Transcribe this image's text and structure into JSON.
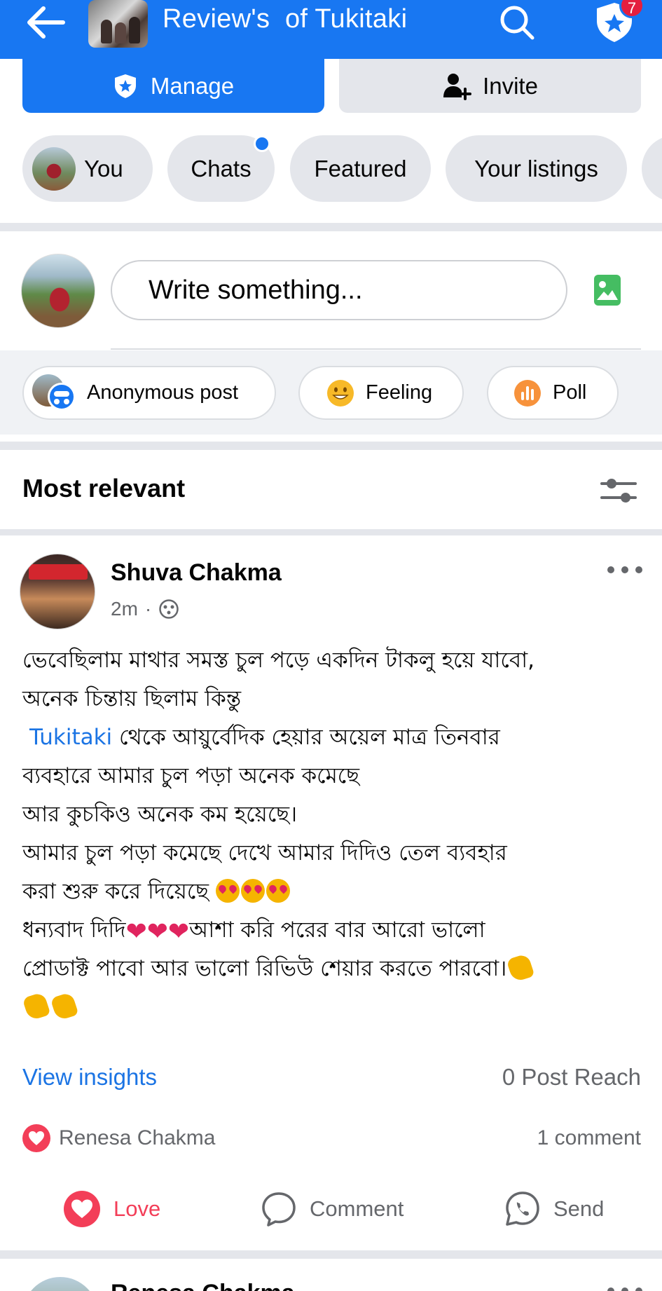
{
  "header": {
    "title": "Review's  of Tukitaki",
    "notification_count": "7"
  },
  "actions": {
    "manage_label": "Manage",
    "invite_label": "Invite"
  },
  "chips": {
    "you": "You",
    "chats": "Chats",
    "featured": "Featured",
    "listings": "Your listings"
  },
  "composer": {
    "placeholder": "Write something...",
    "anonymous_label": "Anonymous post",
    "feeling_label": "Feeling",
    "poll_label": "Poll"
  },
  "sort": {
    "label": "Most relevant"
  },
  "post": {
    "author": "Shuva Chakma",
    "time": "2m",
    "separator": "·",
    "lines": {
      "l1": "ভেবেছিলাম মাথার সমস্ত চুল পড়ে একদিন টাকলু হয়ে যাবো,",
      "l2": "অনেক চিন্তায় ছিলাম কিন্তু",
      "l3_mention": "Tukitaki",
      "l3_rest": " থেকে আয়ুর্বেদিক হেয়ার অয়েল মাত্র তিনবার",
      "l4": "ব্যবহারে আমার চুল পড়া অনেক কমেছে",
      "l5": "আর কুচকিও অনেক কম হয়েছে।",
      "l6": "আমার চুল পড়া কমেছে দেখে আমার দিদিও তেল ব্যবহার",
      "l7": "করা শুরু করে দিয়েছে ",
      "l8a": "ধন্যবাদ দিদি",
      "l8b": "আশা করি পরের বার আরো ভালো",
      "l9": "প্রোডাক্ট পাবো আর ভালো রিভিউ শেয়ার করতে পারবো।"
    },
    "insights_label": "View insights",
    "reach_label": "0 Post Reach",
    "reaction_name": "Renesa Chakma",
    "comment_count": "1 comment",
    "love_label": "Love",
    "comment_label": "Comment",
    "send_label": "Send"
  },
  "next_post": {
    "author": "Renesa Chakma"
  },
  "colors": {
    "brand_blue": "#1877f2",
    "chip_gray": "#e4e6eb",
    "love_red": "#f33e58",
    "link_blue": "#1b74e4"
  },
  "icons": [
    "back-arrow-icon",
    "search-icon",
    "shield-star-icon",
    "person-add-icon",
    "photo-icon",
    "anonymous-icon",
    "feeling-emoji-icon",
    "poll-icon",
    "filter-icon",
    "more-icon",
    "globe-icon",
    "love-icon",
    "comment-icon",
    "send-icon"
  ]
}
